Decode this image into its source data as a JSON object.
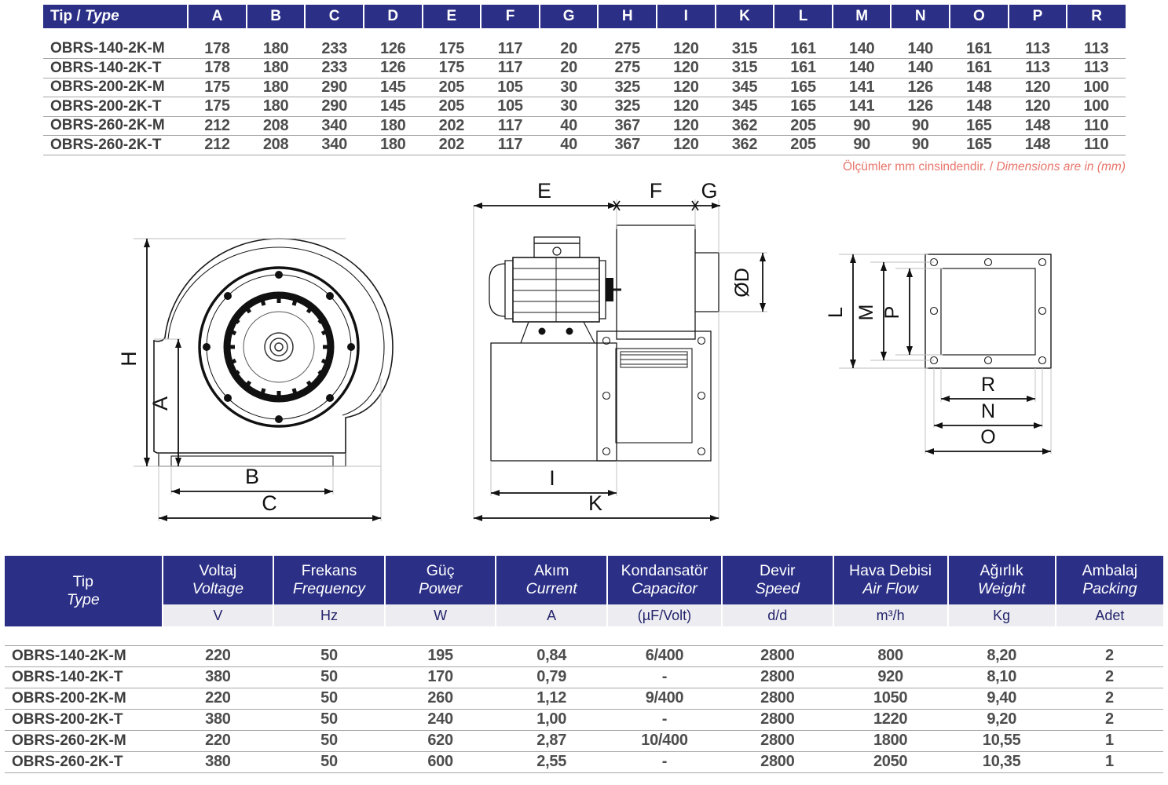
{
  "dimension_table": {
    "headers": [
      "Tip / Type",
      "A",
      "B",
      "C",
      "D",
      "E",
      "F",
      "G",
      "H",
      "I",
      "K",
      "L",
      "M",
      "N",
      "O",
      "P",
      "R"
    ],
    "header_first_tr": "Tip",
    "header_first_sep": " / ",
    "header_first_en": "Type",
    "rows": [
      {
        "type": "OBRS-140-2K-M",
        "values": [
          "178",
          "180",
          "233",
          "126",
          "175",
          "117",
          "20",
          "275",
          "120",
          "315",
          "161",
          "140",
          "140",
          "161",
          "113",
          "113"
        ]
      },
      {
        "type": "OBRS-140-2K-T",
        "values": [
          "178",
          "180",
          "233",
          "126",
          "175",
          "117",
          "20",
          "275",
          "120",
          "315",
          "161",
          "140",
          "140",
          "161",
          "113",
          "113"
        ]
      },
      {
        "type": "OBRS-200-2K-M",
        "values": [
          "175",
          "180",
          "290",
          "145",
          "205",
          "105",
          "30",
          "325",
          "120",
          "345",
          "165",
          "141",
          "126",
          "148",
          "120",
          "100"
        ]
      },
      {
        "type": "OBRS-200-2K-T",
        "values": [
          "175",
          "180",
          "290",
          "145",
          "205",
          "105",
          "30",
          "325",
          "120",
          "345",
          "165",
          "141",
          "126",
          "148",
          "120",
          "100"
        ]
      },
      {
        "type": "OBRS-260-2K-M",
        "values": [
          "212",
          "208",
          "340",
          "180",
          "202",
          "117",
          "40",
          "367",
          "120",
          "362",
          "205",
          "90",
          "90",
          "165",
          "148",
          "110"
        ]
      },
      {
        "type": "OBRS-260-2K-T",
        "values": [
          "212",
          "208",
          "340",
          "180",
          "202",
          "117",
          "40",
          "367",
          "120",
          "362",
          "205",
          "90",
          "90",
          "165",
          "148",
          "110"
        ]
      }
    ]
  },
  "note": {
    "tr": "Ölçümler mm cinsindendir.",
    "sep": " / ",
    "en": "Dimensions are in (mm)"
  },
  "drawings": {
    "front_view": {
      "name": "centrifugal-fan-front-view",
      "labels": [
        "H",
        "A",
        "B",
        "C"
      ]
    },
    "top_view": {
      "name": "centrifugal-fan-top-view",
      "labels": [
        "E",
        "F",
        "G",
        "ØD",
        "I",
        "K"
      ]
    },
    "flange_view": {
      "name": "outlet-flange-view",
      "labels": [
        "L",
        "M",
        "P",
        "R",
        "N",
        "O"
      ]
    }
  },
  "spec_table": {
    "columns": [
      {
        "tr": "Tip",
        "en": "Type",
        "unit": ""
      },
      {
        "tr": "Voltaj",
        "en": "Voltage",
        "unit": "V"
      },
      {
        "tr": "Frekans",
        "en": "Frequency",
        "unit": "Hz"
      },
      {
        "tr": "Güç",
        "en": "Power",
        "unit": "W"
      },
      {
        "tr": "Akım",
        "en": "Current",
        "unit": "A"
      },
      {
        "tr": "Kondansatör",
        "en": "Capacitor",
        "unit": "(µF/Volt)"
      },
      {
        "tr": "Devir",
        "en": "Speed",
        "unit": "d/d"
      },
      {
        "tr": "Hava Debisi",
        "en": "Air Flow",
        "unit": "m³/h"
      },
      {
        "tr": "Ağırlık",
        "en": "Weight",
        "unit": "Kg"
      },
      {
        "tr": "Ambalaj",
        "en": "Packing",
        "unit": "Adet"
      }
    ],
    "rows": [
      {
        "type": "OBRS-140-2K-M",
        "values": [
          "220",
          "50",
          "195",
          "0,84",
          "6/400",
          "2800",
          "800",
          "8,20",
          "2"
        ]
      },
      {
        "type": "OBRS-140-2K-T",
        "values": [
          "380",
          "50",
          "170",
          "0,79",
          "-",
          "2800",
          "920",
          "8,10",
          "2"
        ]
      },
      {
        "type": "OBRS-200-2K-M",
        "values": [
          "220",
          "50",
          "260",
          "1,12",
          "9/400",
          "2800",
          "1050",
          "9,40",
          "2"
        ]
      },
      {
        "type": "OBRS-200-2K-T",
        "values": [
          "380",
          "50",
          "240",
          "1,00",
          "-",
          "2800",
          "1220",
          "9,20",
          "2"
        ]
      },
      {
        "type": "OBRS-260-2K-M",
        "values": [
          "220",
          "50",
          "620",
          "2,87",
          "10/400",
          "2800",
          "1800",
          "10,55",
          "1"
        ]
      },
      {
        "type": "OBRS-260-2K-T",
        "values": [
          "380",
          "50",
          "600",
          "2,55",
          "-",
          "2800",
          "2050",
          "10,35",
          "1"
        ]
      }
    ]
  },
  "colors": {
    "header_blue": "#2b2f86",
    "unit_bg": "#ededf1",
    "rule": "#a6a6a6",
    "note_red": "#e8756b",
    "data_text": "#4d4d4d"
  }
}
